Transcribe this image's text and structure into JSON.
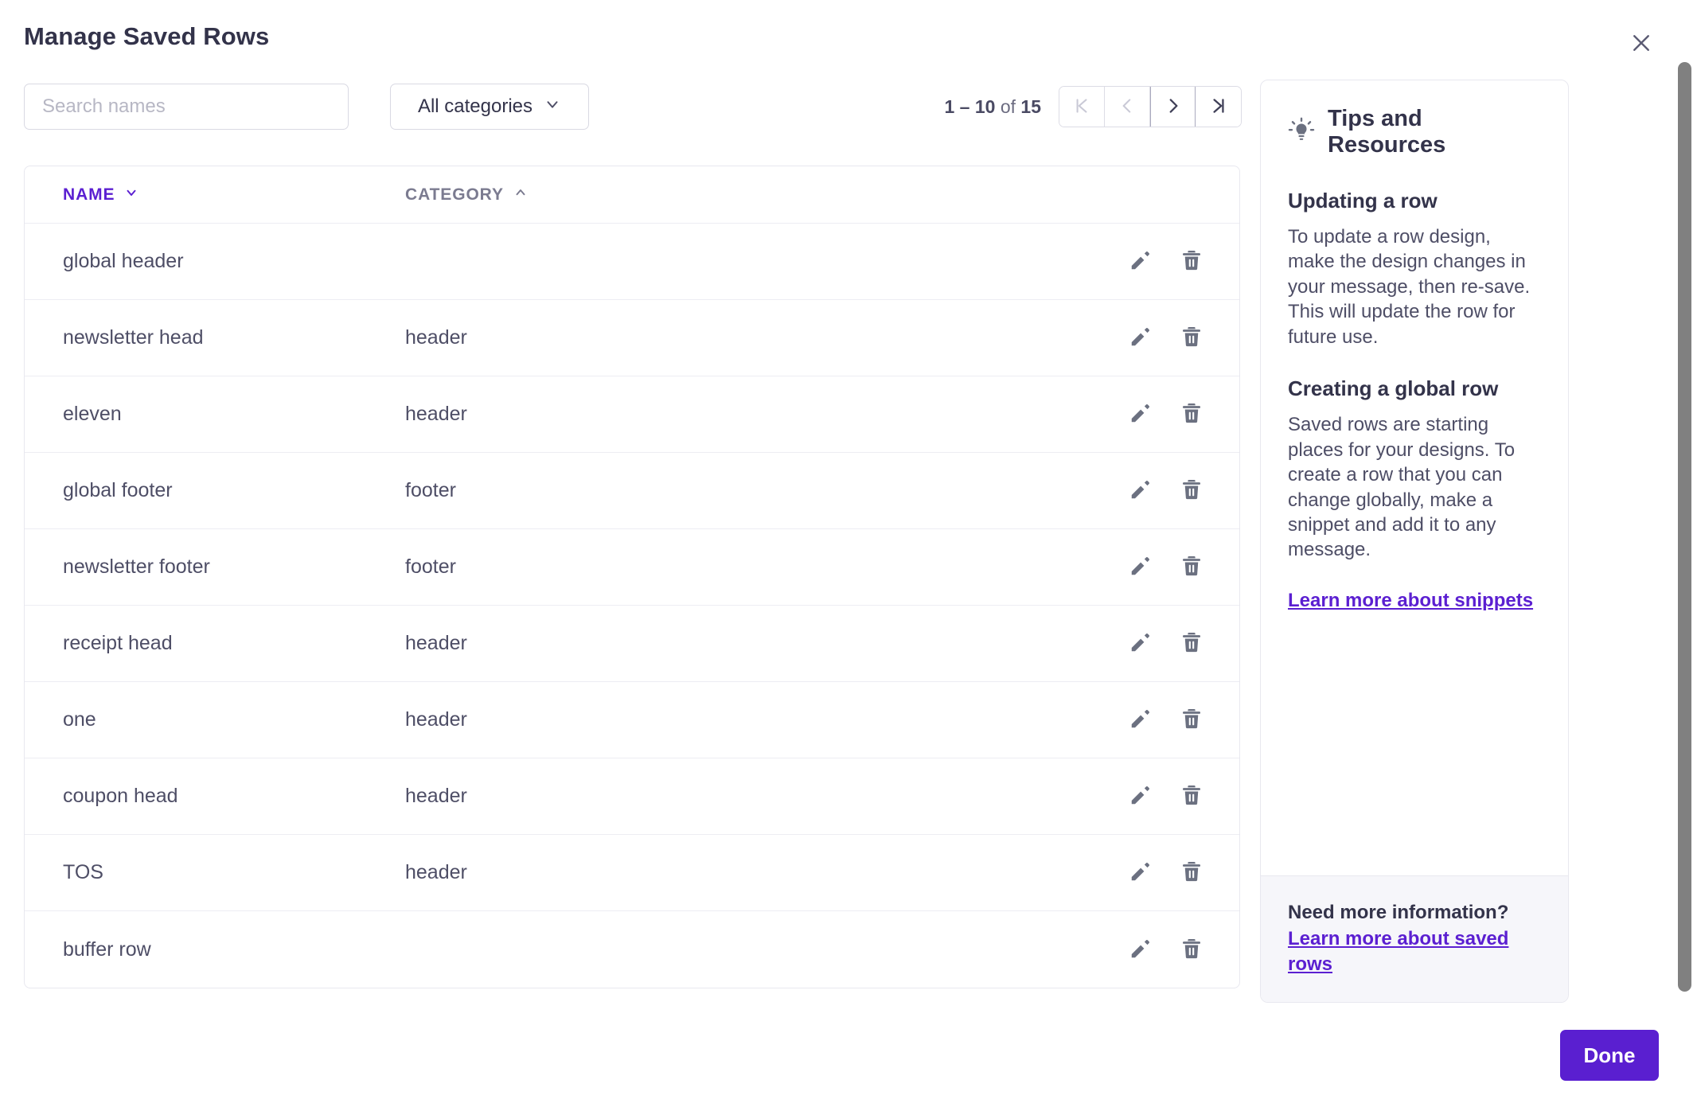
{
  "dialog": {
    "title": "Manage Saved Rows",
    "close_label": "Close"
  },
  "toolbar": {
    "search_placeholder": "Search names",
    "search_value": "",
    "category_filter": "All categories"
  },
  "pagination": {
    "range_start": "1 – 10",
    "range_of": " of ",
    "range_total": "15",
    "first_label": "First page",
    "prev_label": "Previous page",
    "next_label": "Next page",
    "last_label": "Last page"
  },
  "table": {
    "columns": [
      {
        "key": "name",
        "label": "NAME",
        "sort": "desc",
        "active": true
      },
      {
        "key": "category",
        "label": "CATEGORY",
        "sort": "asc",
        "active": false
      }
    ],
    "rows": [
      {
        "name": "global header",
        "category": ""
      },
      {
        "name": "newsletter head",
        "category": "header"
      },
      {
        "name": "eleven",
        "category": "header"
      },
      {
        "name": "global footer",
        "category": "footer"
      },
      {
        "name": "newsletter footer",
        "category": "footer"
      },
      {
        "name": "receipt head",
        "category": "header"
      },
      {
        "name": "one",
        "category": "header"
      },
      {
        "name": "coupon head",
        "category": "header"
      },
      {
        "name": "TOS",
        "category": "header"
      },
      {
        "name": "buffer row",
        "category": ""
      }
    ],
    "row_actions": {
      "edit_label": "Edit",
      "delete_label": "Delete"
    }
  },
  "tips": {
    "heading": "Tips and Resources",
    "sections": [
      {
        "title": "Updating a row",
        "body": "To update a row design, make the design changes in your message, then re-save. This will update the row for future use."
      },
      {
        "title": "Creating a global row",
        "body": "Saved rows are starting places for your designs. To create a row that you can change globally, make a snippet and add it to any message."
      }
    ],
    "link": "Learn more about snippets",
    "footer_text": "Need more information? ",
    "footer_link": "Learn more about saved rows"
  },
  "footer": {
    "done_label": "Done"
  },
  "colors": {
    "accent": "#5b1fd1",
    "primary_button": "#5a1fd0",
    "text": "#33334a",
    "muted_text": "#6b6b80",
    "border": "#e8e8ef",
    "icon": "#6b7080"
  }
}
